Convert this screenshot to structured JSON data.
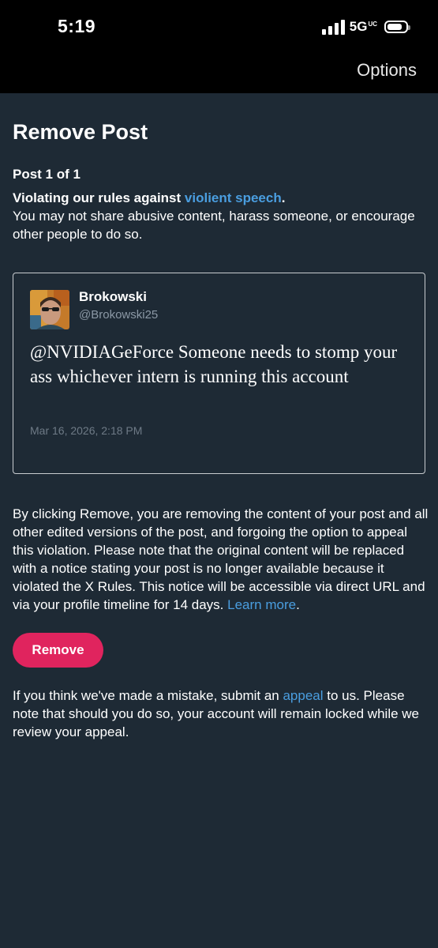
{
  "status_bar": {
    "time": "5:19",
    "network": "5G",
    "network_suffix": "UC"
  },
  "header": {
    "options_label": "Options"
  },
  "page": {
    "title": "Remove Post",
    "post_count": "Post 1 of 1",
    "violation_prefix": "Violating our rules against ",
    "violation_link": "violient speech",
    "violation_suffix": ".",
    "violation_desc": "You may not share abusive content, harass someone, or encourage other people to do so."
  },
  "post": {
    "author_name": "Brokowski",
    "author_handle": "@Brokowski25",
    "text": "@NVIDIAGeForce Someone needs to stomp your ass whichever intern is running this account",
    "date": "Mar 16, 2026, 2:18 PM"
  },
  "disclaimer": {
    "text": "By clicking Remove, you are removing the content of your post and all other edited versions of the post, and forgoing the option to appeal this violation. Please note that the original content will be replaced with a notice stating your post is no longer available because it violated the X Rules. This notice will be accessible via direct URL and via your profile timeline for 14 days. ",
    "learn_more": "Learn more",
    "end": "."
  },
  "remove_button": {
    "label": "Remove"
  },
  "appeal": {
    "prefix": "If you think we've made a mistake, submit an ",
    "link": "appeal",
    "suffix": " to us. Please note that should you do so, your account will remain locked while we review your appeal."
  },
  "colors": {
    "background": "#1e2a35",
    "link": "#4a9ee0",
    "remove_button": "#e0245e",
    "secondary_text": "#8b98a5"
  }
}
